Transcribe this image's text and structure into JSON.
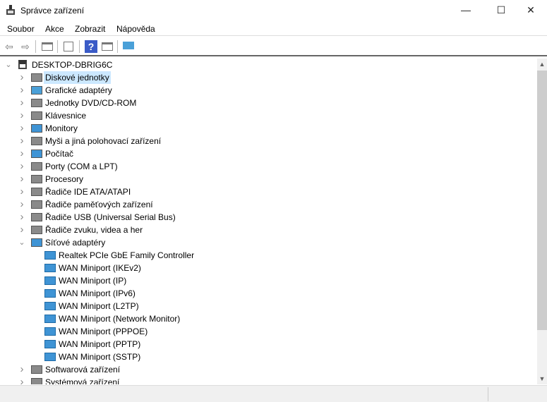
{
  "window": {
    "title": "Správce zařízení",
    "minimize": "—",
    "maximize": "☐",
    "close": "✕"
  },
  "menu": [
    "Soubor",
    "Akce",
    "Zobrazit",
    "Nápověda"
  ],
  "toolbar": {
    "back": "⇦",
    "forward": "⇨",
    "help": "?"
  },
  "tree": {
    "root": "DESKTOP-DBRIG6C",
    "categories": [
      {
        "label": "Diskové jednotky",
        "icon": "disk-drive-icon",
        "selected": true
      },
      {
        "label": "Grafické adaptéry",
        "icon": "display-adapter-icon"
      },
      {
        "label": "Jednotky DVD/CD-ROM",
        "icon": "dvd-drive-icon"
      },
      {
        "label": "Klávesnice",
        "icon": "keyboard-icon"
      },
      {
        "label": "Monitory",
        "icon": "monitor-icon"
      },
      {
        "label": "Myši a jiná polohovací zařízení",
        "icon": "mouse-icon"
      },
      {
        "label": "Počítač",
        "icon": "computer-icon"
      },
      {
        "label": "Porty (COM a LPT)",
        "icon": "port-icon"
      },
      {
        "label": "Procesory",
        "icon": "processor-icon"
      },
      {
        "label": "Řadiče IDE ATA/ATAPI",
        "icon": "ide-controller-icon"
      },
      {
        "label": "Řadiče paměťových zařízení",
        "icon": "storage-controller-icon"
      },
      {
        "label": "Řadiče USB (Universal Serial Bus)",
        "icon": "usb-icon"
      },
      {
        "label": "Řadiče zvuku, videa a her",
        "icon": "sound-icon"
      },
      {
        "label": "Síťové adaptéry",
        "icon": "network-adapter-icon",
        "expanded": true,
        "children": [
          "Realtek PCIe GbE Family Controller",
          "WAN Miniport (IKEv2)",
          "WAN Miniport (IP)",
          "WAN Miniport (IPv6)",
          "WAN Miniport (L2TP)",
          "WAN Miniport (Network Monitor)",
          "WAN Miniport (PPPOE)",
          "WAN Miniport (PPTP)",
          "WAN Miniport (SSTP)"
        ]
      },
      {
        "label": "Softwarová zařízení",
        "icon": "software-device-icon"
      },
      {
        "label": "Systémová zařízení",
        "icon": "system-device-icon"
      }
    ]
  }
}
